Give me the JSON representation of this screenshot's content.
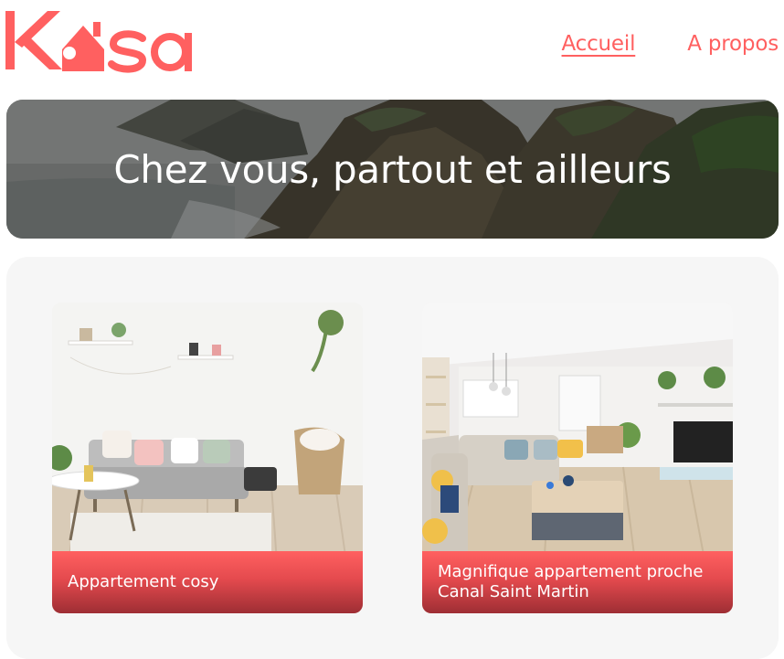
{
  "brand": {
    "name": "Kasa",
    "accent": "#FF6060"
  },
  "nav": {
    "items": [
      {
        "label": "Accueil",
        "active": true
      },
      {
        "label": "A propos",
        "active": false
      }
    ]
  },
  "banner": {
    "title": "Chez vous, partout et ailleurs"
  },
  "listings": [
    {
      "title": "Appartement cosy"
    },
    {
      "title": "Magnifique appartement proche Canal Saint Martin"
    }
  ]
}
